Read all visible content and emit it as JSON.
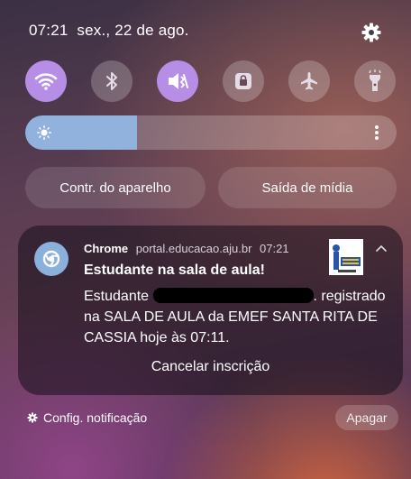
{
  "status": {
    "time": "07:21",
    "date": "sex., 22 de ago."
  },
  "quick_settings": {
    "tiles": [
      {
        "name": "wifi",
        "state": "on"
      },
      {
        "name": "bluetooth",
        "state": "off"
      },
      {
        "name": "sound-mute",
        "state": "on"
      },
      {
        "name": "portrait-lock",
        "state": "off"
      },
      {
        "name": "airplane-mode",
        "state": "off"
      },
      {
        "name": "flashlight",
        "state": "off"
      }
    ],
    "brightness_level": 0.3
  },
  "buttons": {
    "device_control": "Contr. do aparelho",
    "media_output": "Saída de mídia"
  },
  "notification": {
    "app": "Chrome",
    "source": "portal.educacao.aju.br",
    "time": "07:21",
    "title": "Estudante na sala de aula!",
    "body_prefix": "Estudante ",
    "body_suffix": ". registrado na SALA DE AULA da EMEF SANTA RITA DE CASSIA hoje às 07:11.",
    "action": "Cancelar inscrição"
  },
  "footer": {
    "settings_label": "Config. notificação",
    "clear_label": "Apagar"
  },
  "colors": {
    "accent_on": "#b68ee6",
    "brightness_fill": "#92b2de",
    "chrome_icon_bg": "#8ab0dc"
  }
}
